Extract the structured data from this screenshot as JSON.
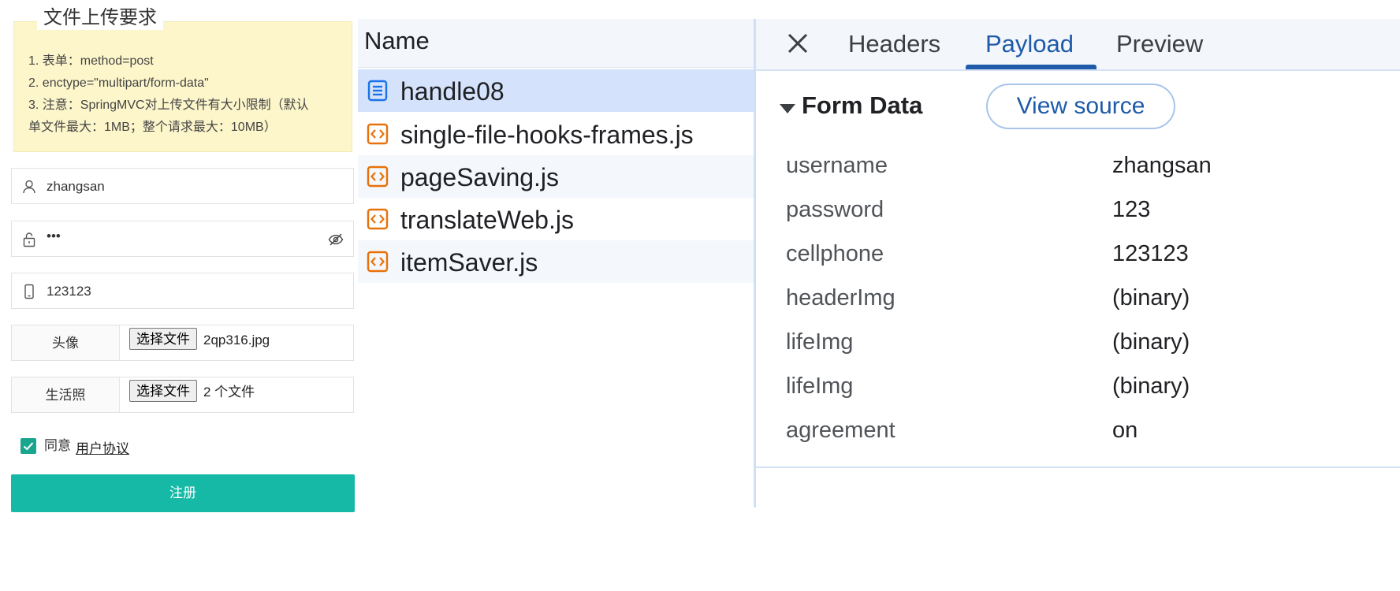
{
  "form": {
    "requirements_title": "文件上传要求",
    "requirements": [
      "1. 表单：method=post",
      "2. enctype=\"multipart/form-data\"",
      "3. 注意：SpringMVC对上传文件有大小限制（默认",
      "单文件最大：1MB；整个请求最大：10MB）"
    ],
    "username_value": "zhangsan",
    "password_value": "•••",
    "phone_value": "123123",
    "avatar_label": "头像",
    "avatar_button": "选择文件",
    "avatar_file": "2qp316.jpg",
    "life_label": "生活照",
    "life_button": "选择文件",
    "life_file": "2 个文件",
    "agree_text": "同意",
    "agree_link": "用户协议",
    "submit_label": "注册",
    "accent_color": "#16b8a6"
  },
  "network": {
    "column_header": "Name",
    "requests": [
      {
        "name": "handle08",
        "icon": "document-icon",
        "selected": true
      },
      {
        "name": "single-file-hooks-frames.js",
        "icon": "script-icon"
      },
      {
        "name": "pageSaving.js",
        "icon": "script-icon"
      },
      {
        "name": "translateWeb.js",
        "icon": "script-icon"
      },
      {
        "name": "itemSaver.js",
        "icon": "script-icon"
      }
    ]
  },
  "details": {
    "tabs": [
      "Headers",
      "Payload",
      "Preview"
    ],
    "active_tab": "Payload",
    "section_title": "Form Data",
    "view_source_label": "View source",
    "fields": [
      {
        "key": "username",
        "value": "zhangsan"
      },
      {
        "key": "password",
        "value": "123"
      },
      {
        "key": "cellphone",
        "value": "123123"
      },
      {
        "key": "headerImg",
        "value": "(binary)"
      },
      {
        "key": "lifeImg",
        "value": "(binary)"
      },
      {
        "key": "lifeImg",
        "value": "(binary)"
      },
      {
        "key": "agreement",
        "value": "on"
      }
    ]
  }
}
